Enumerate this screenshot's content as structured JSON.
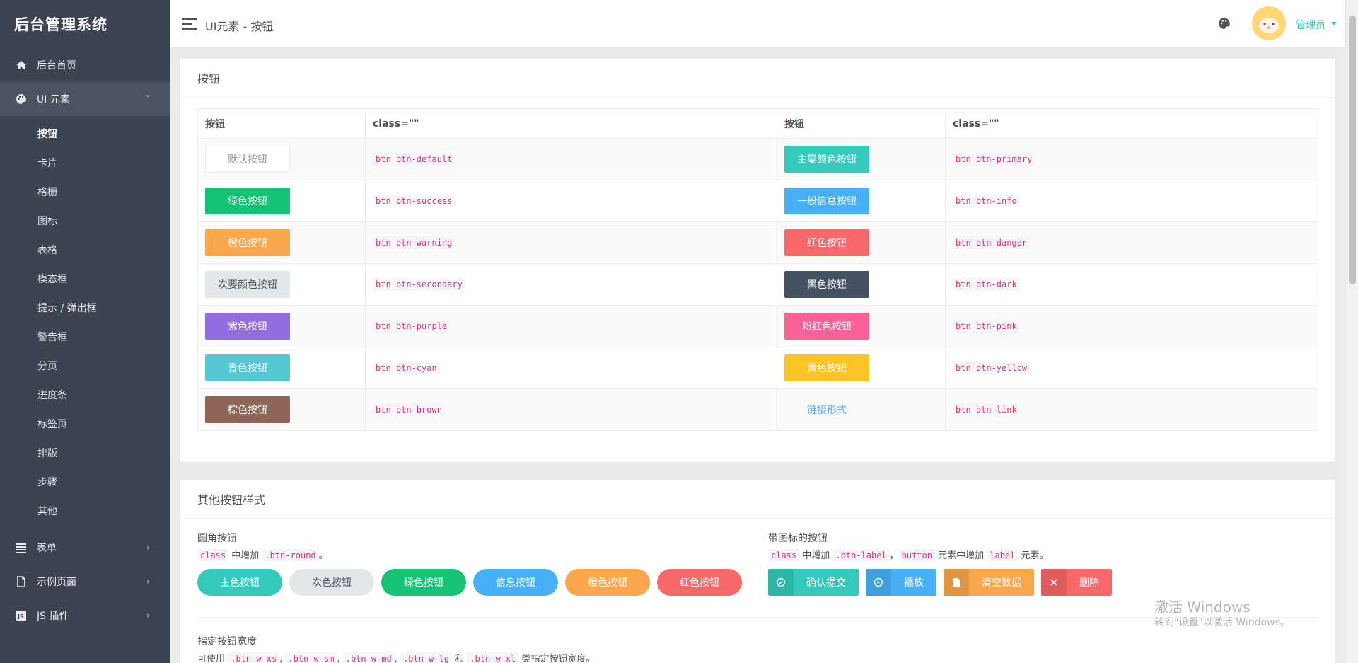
{
  "sidebar": {
    "brand": "后台管理系统",
    "items": [
      {
        "label": "后台首页",
        "icon": "home-icon"
      },
      {
        "label": "UI 元素",
        "icon": "palette-icon",
        "caret": "˅"
      },
      {
        "label": "表单",
        "icon": "list-icon",
        "caret": "›"
      },
      {
        "label": "示例页面",
        "icon": "file-icon",
        "caret": "›"
      },
      {
        "label": "JS 插件",
        "icon": "plugin-icon",
        "caret": "›"
      }
    ],
    "submenu": [
      "按钮",
      "卡片",
      "格栅",
      "图标",
      "表格",
      "模态框",
      "提示 / 弹出框",
      "警告框",
      "分页",
      "进度条",
      "标签页",
      "排版",
      "步骤",
      "其他"
    ]
  },
  "header": {
    "title": "UI元素 - 按钮",
    "user": "管理员"
  },
  "card1": {
    "title": "按钮",
    "columns": [
      "按钮",
      "class=\"\"",
      "按钮",
      "class=\"\""
    ],
    "rows": [
      {
        "l_label": "默认按钮",
        "l_class": "btn btn-default",
        "r_label": "主要颜色按钮",
        "r_class": "btn btn-primary"
      },
      {
        "l_label": "绿色按钮",
        "l_class": "btn btn-success",
        "r_label": "一般信息按钮",
        "r_class": "btn btn-info"
      },
      {
        "l_label": "橙色按钮",
        "l_class": "btn btn-warning",
        "r_label": "红色按钮",
        "r_class": "btn btn-danger"
      },
      {
        "l_label": "次要颜色按钮",
        "l_class": "btn btn-secondary",
        "r_label": "黑色按钮",
        "r_class": "btn btn-dark"
      },
      {
        "l_label": "紫色按钮",
        "l_class": "btn btn-purple",
        "r_label": "粉红色按钮",
        "r_class": "btn btn-pink"
      },
      {
        "l_label": "青色按钮",
        "l_class": "btn btn-cyan",
        "r_label": "黄色按钮",
        "r_class": "btn btn-yellow"
      },
      {
        "l_label": "棕色按钮",
        "l_class": "btn btn-brown",
        "r_label": "链接形式",
        "r_class": "btn btn-link"
      }
    ]
  },
  "card2": {
    "title": "其他按钮样式",
    "round": {
      "label": "圆角按钮",
      "desc_code1": "class",
      "desc_text1": " 中增加 ",
      "desc_code2": ".btn-round",
      "desc_text2": "。",
      "buttons": [
        "主色按钮",
        "次色按钮",
        "绿色按钮",
        "信息按钮",
        "橙色按钮",
        "红色按钮"
      ]
    },
    "icons": {
      "label": "带图标的按钮",
      "desc_code1": "class",
      "desc_text1": " 中增加 ",
      "desc_code2": ".btn-label",
      "desc_text2": "，",
      "desc_code3": "button",
      "desc_text3": " 元素中增加 ",
      "desc_code4": "label",
      "desc_text4": " 元素。",
      "buttons": [
        "确认提交",
        "播放",
        "清空数据",
        "删除"
      ]
    },
    "width": {
      "label": "指定按钮宽度",
      "desc_text1": "可使用 ",
      "codes": [
        ".btn-w-xs",
        ".btn-w-sm",
        ".btn-w-md",
        ".btn-w-lg",
        ".btn-w-xl"
      ],
      "desc_and": " 和 ",
      "desc_text2": " 类指定按钮宽度。"
    }
  },
  "watermark": {
    "line1": "激活 Windows",
    "line2": "转到\"设置\"以激活 Windows。"
  },
  "colors": {
    "primary": "#33cabb",
    "sidebar": "#3c4452"
  }
}
